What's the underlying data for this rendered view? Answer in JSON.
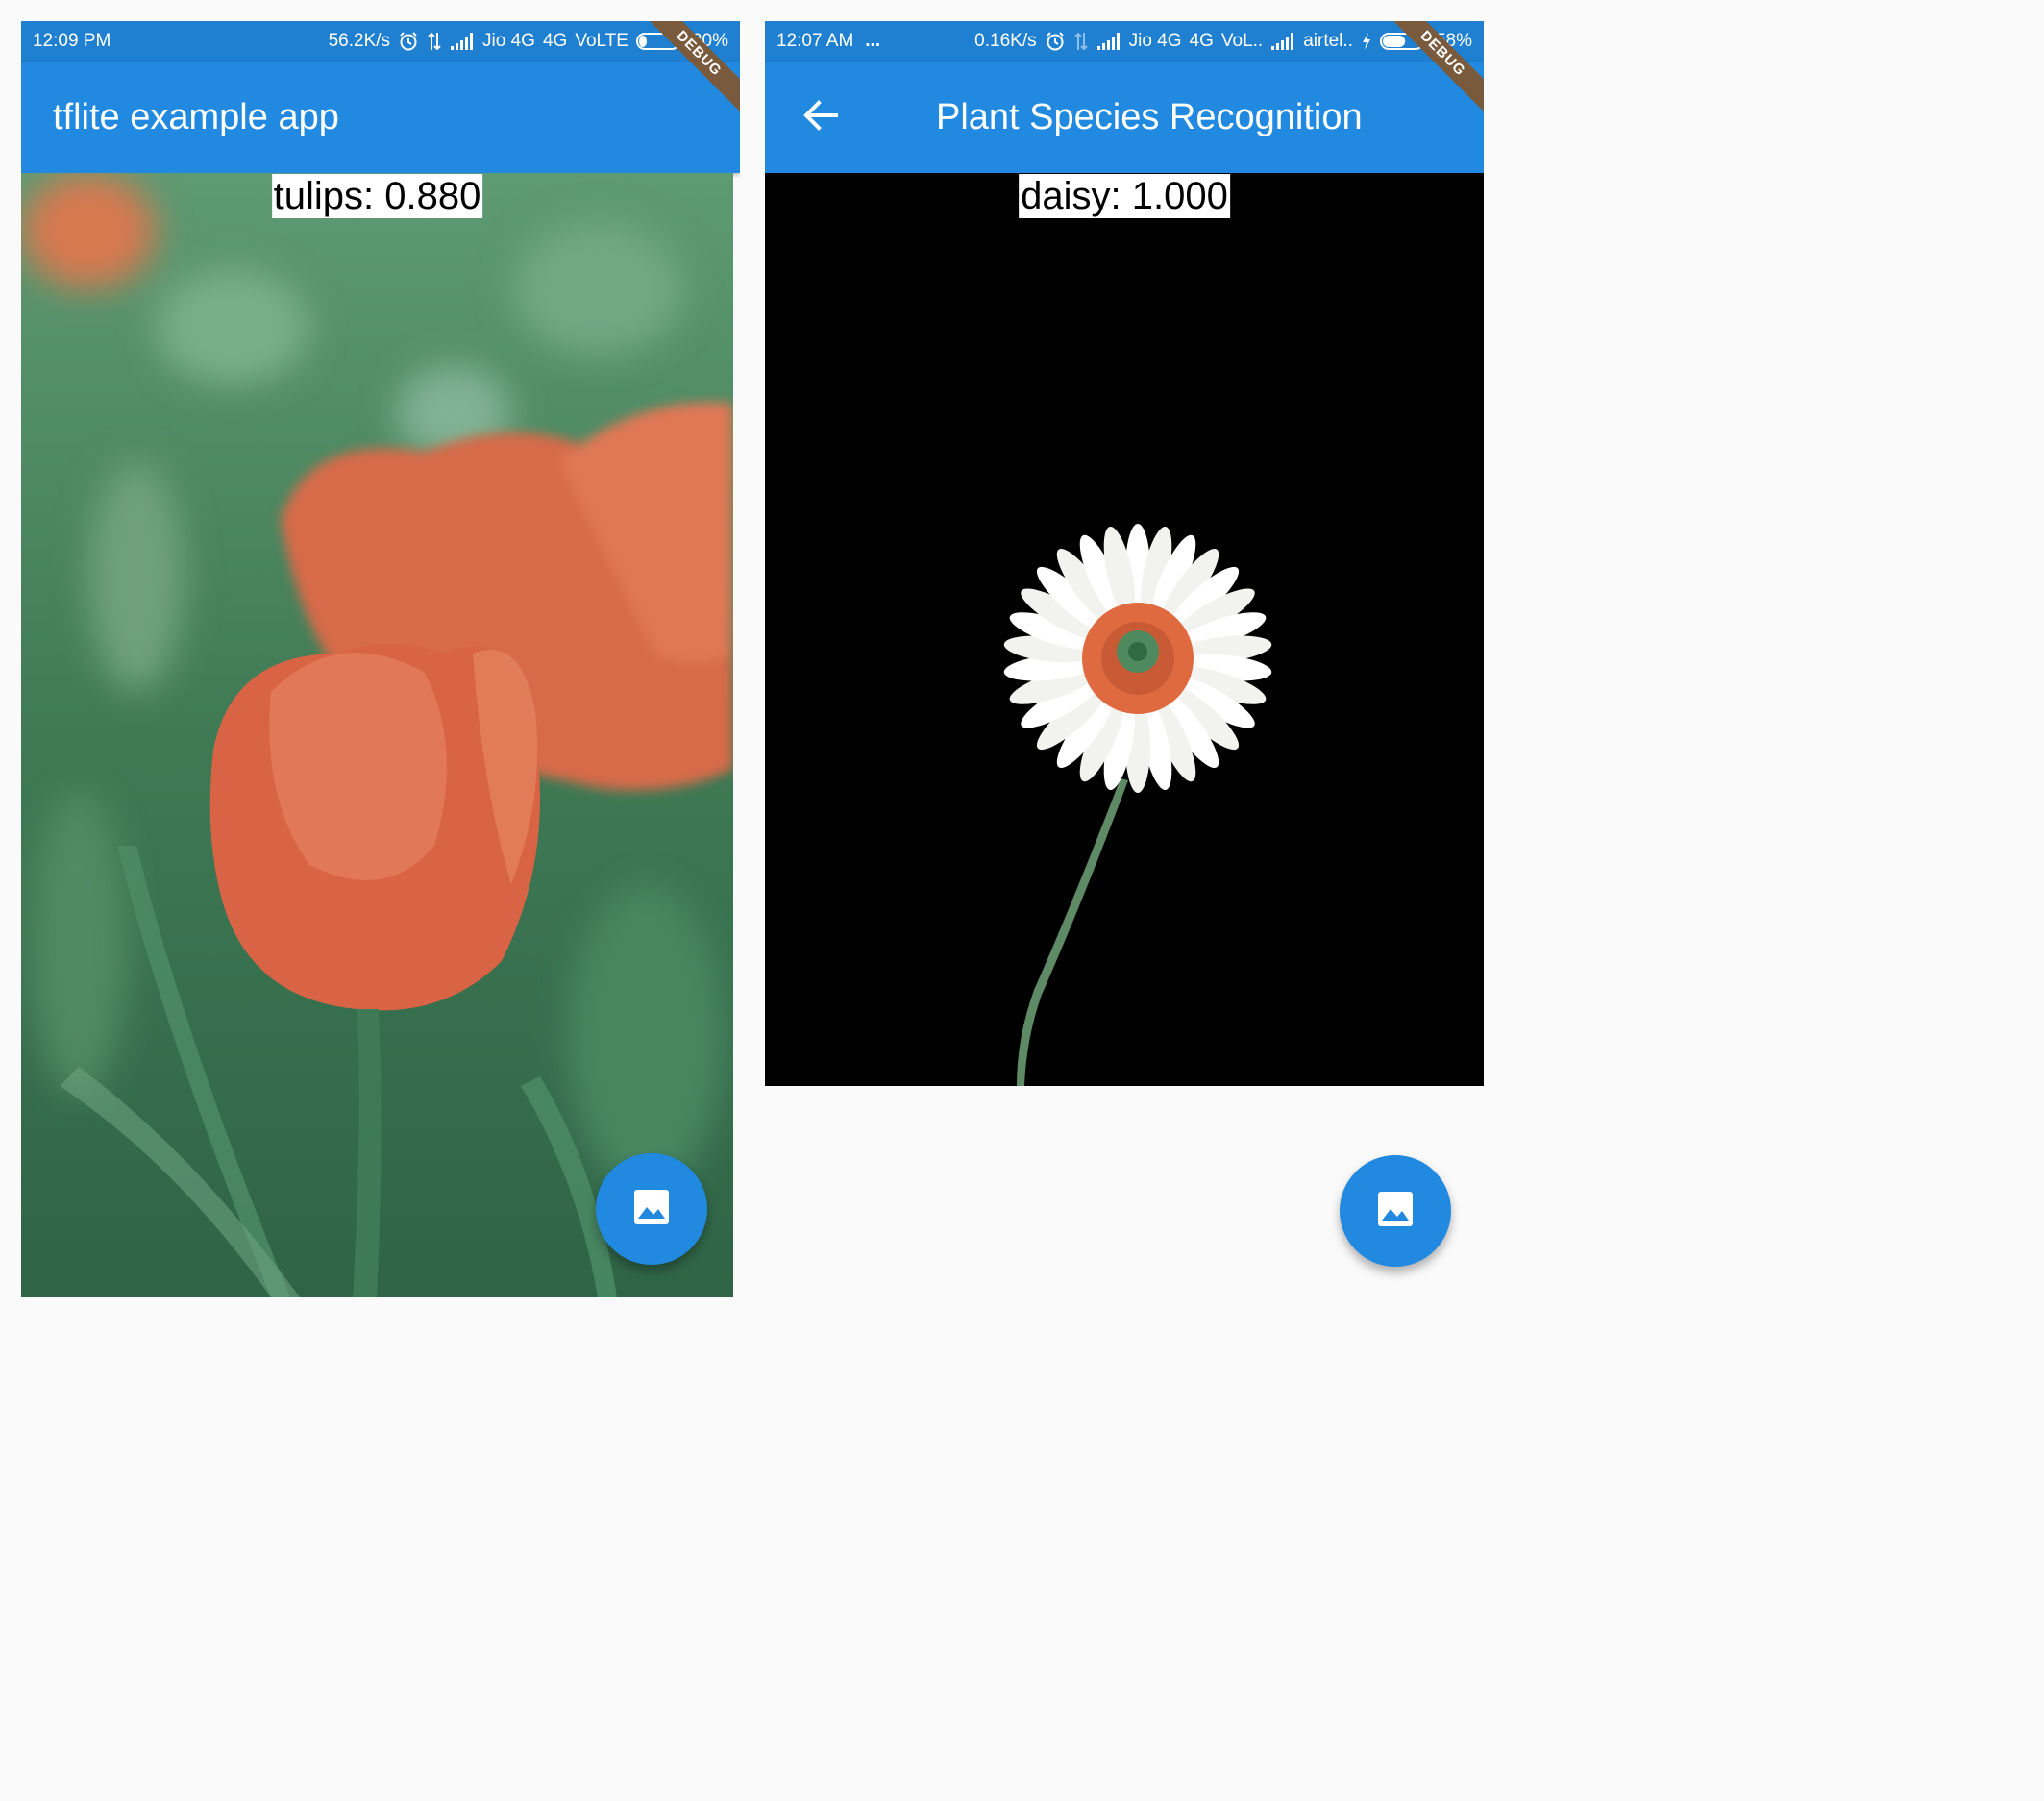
{
  "screens": [
    {
      "status_bar": {
        "time": "12:09 PM",
        "net_speed": "56.2K/s",
        "carrier": "Jio 4G",
        "network_type": "4G",
        "volte": "VoLTE",
        "battery": "20%",
        "battery_level": 0.2
      },
      "app_bar": {
        "title": "tflite example app"
      },
      "debug_banner": "DEBUG",
      "result": "tulips: 0.880",
      "fab": {
        "icon": "image-icon"
      },
      "colors": {
        "appbar": "#2189e0",
        "statusbar": "#1f7fd0",
        "photo_background": "#3f7a55"
      }
    },
    {
      "status_bar": {
        "time": "12:07 AM",
        "more": "...",
        "net_speed": "0.16K/s",
        "carrier": "Jio 4G",
        "network_type": "4G",
        "volte": "VoL..",
        "carrier2": "airtel..",
        "battery": "58%",
        "battery_level": 0.58
      },
      "app_bar": {
        "title": "Plant Species Recognition",
        "back_icon": "arrow-back-icon"
      },
      "debug_banner": "DEBUG",
      "result": "daisy: 1.000",
      "fab": {
        "icon": "image-icon"
      },
      "colors": {
        "appbar": "#2189e0",
        "statusbar": "#1f7fd0",
        "photo_background": "#000000"
      }
    }
  ]
}
